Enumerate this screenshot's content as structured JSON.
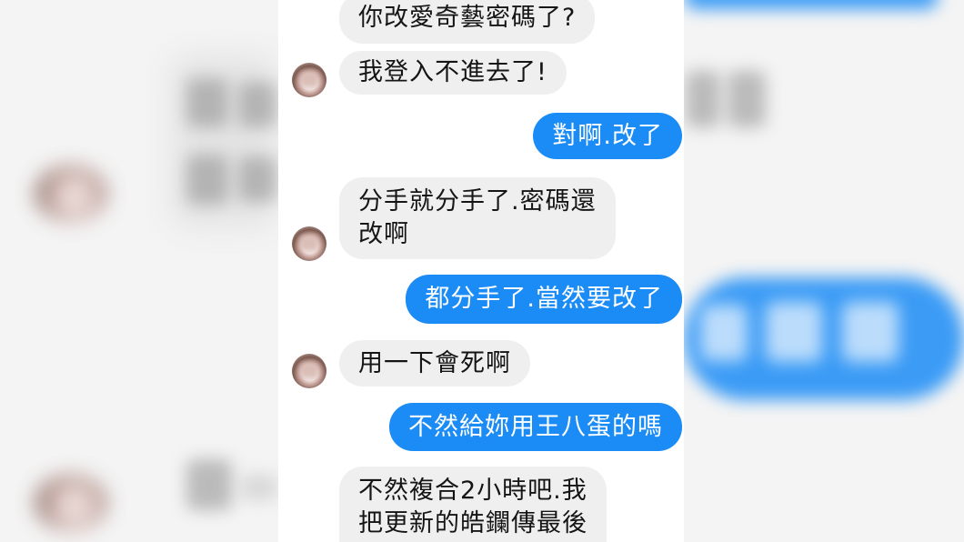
{
  "theme": {
    "sent_bubble_color": "#1b8cf6",
    "received_bubble_color": "#efefef",
    "sent_text_color": "#ffffff",
    "received_text_color": "#151515"
  },
  "icons": {
    "contact_avatar": "avatar-photo-icon"
  },
  "conversation": {
    "messages": [
      {
        "outgoing": false,
        "lines": [
          "你改愛奇藝密碼了?"
        ]
      },
      {
        "outgoing": false,
        "lines": [
          "我登入不進去了!"
        ]
      },
      {
        "outgoing": true,
        "lines": [
          "對啊.改了"
        ]
      },
      {
        "outgoing": false,
        "lines": [
          "分手就分手了.密碼還",
          "改啊"
        ]
      },
      {
        "outgoing": true,
        "lines": [
          "都分手了.當然要改了"
        ]
      },
      {
        "outgoing": false,
        "lines": [
          "用一下會死啊"
        ]
      },
      {
        "outgoing": true,
        "lines": [
          "不然給妳用王八蛋的嗎"
        ]
      },
      {
        "outgoing": false,
        "lines": [
          "不然複合2小時吧.我",
          "把更新的皓鑭傳最後"
        ]
      }
    ]
  }
}
